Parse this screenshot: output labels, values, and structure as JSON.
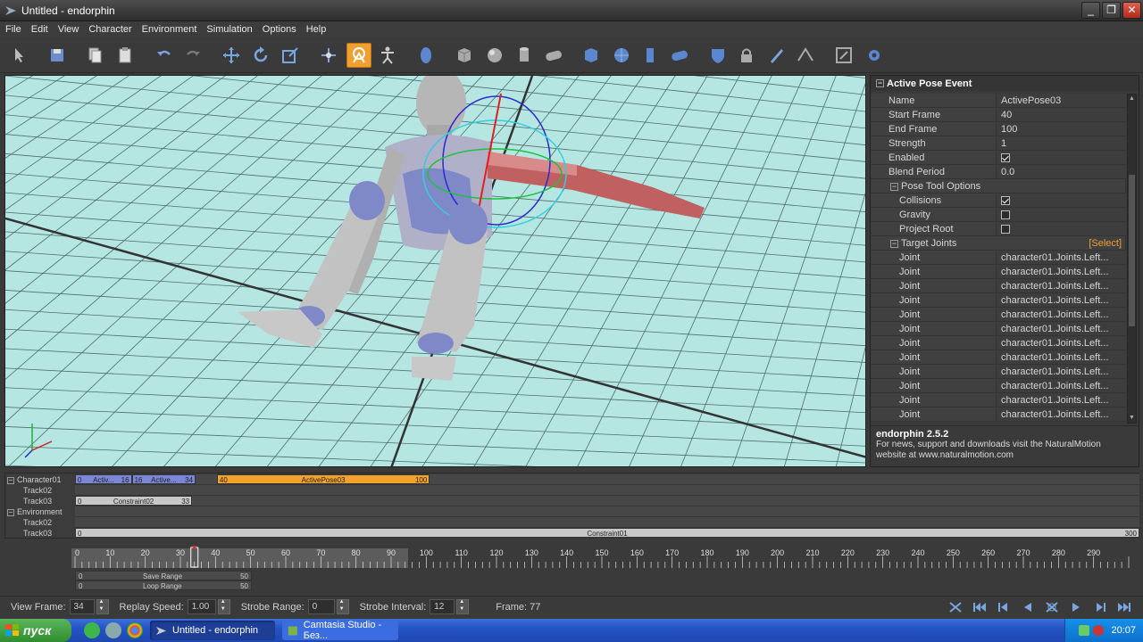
{
  "window": {
    "title": "Untitled - endorphin",
    "minimize": "_",
    "maximize": "❐",
    "close": "✕"
  },
  "menu": [
    "File",
    "Edit",
    "View",
    "Character",
    "Environment",
    "Simulation",
    "Options",
    "Help"
  ],
  "toolbar": {
    "icons": [
      "select-icon",
      "save-icon",
      "copy-icon",
      "paste-icon",
      "undo-icon",
      "redo-icon",
      "move-icon",
      "rotate-icon",
      "scale-icon",
      "joint-move-icon",
      "pose-tool-icon",
      "character-icon",
      "shield-icon",
      "box-icon",
      "sphere-icon",
      "cylinder-icon",
      "capsule-icon",
      "box-blue-icon",
      "mesh-sphere-icon",
      "cylinder-blue-icon",
      "capsule-blue-icon",
      "shield-blue-icon",
      "lock-icon",
      "pen-icon",
      "ruler-icon",
      "export-icon",
      "settings-icon"
    ],
    "active": "pose-tool-icon"
  },
  "viewport": {
    "overlay_label": ""
  },
  "properties": {
    "header": "Active Pose Event",
    "rows": [
      {
        "key": "Name",
        "value": "ActivePose03"
      },
      {
        "key": "Start Frame",
        "value": "40"
      },
      {
        "key": "End Frame",
        "value": "100"
      },
      {
        "key": "Strength",
        "value": "1"
      },
      {
        "key": "Enabled",
        "checked": true
      },
      {
        "key": "Blend Period",
        "value": "0.0"
      }
    ],
    "pose_tool_options": {
      "label": "Pose Tool Options",
      "rows": [
        {
          "key": "Collisions",
          "checked": true
        },
        {
          "key": "Gravity",
          "checked": false
        },
        {
          "key": "Project Root",
          "checked": false
        }
      ]
    },
    "target_joints": {
      "label": "Target Joints",
      "select_label": "[Select]",
      "rows": [
        {
          "key": "Joint",
          "value": "character01.Joints.Left..."
        },
        {
          "key": "Joint",
          "value": "character01.Joints.Left..."
        },
        {
          "key": "Joint",
          "value": "character01.Joints.Left..."
        },
        {
          "key": "Joint",
          "value": "character01.Joints.Left..."
        },
        {
          "key": "Joint",
          "value": "character01.Joints.Left..."
        },
        {
          "key": "Joint",
          "value": "character01.Joints.Left..."
        },
        {
          "key": "Joint",
          "value": "character01.Joints.Left..."
        },
        {
          "key": "Joint",
          "value": "character01.Joints.Left..."
        },
        {
          "key": "Joint",
          "value": "character01.Joints.Left..."
        },
        {
          "key": "Joint",
          "value": "character01.Joints.Left..."
        },
        {
          "key": "Joint",
          "value": "character01.Joints.Left..."
        },
        {
          "key": "Joint",
          "value": "character01.Joints.Left..."
        }
      ]
    }
  },
  "info": {
    "title": "endorphin 2.5.2",
    "text": "For news, support and downloads visit the NaturalMotion website at www.naturalmotion.com"
  },
  "tracks": [
    {
      "label": "Character01",
      "group": true,
      "clips": [
        {
          "start_label": "0",
          "center": "Activ...",
          "end_label": "16",
          "color": "#7b86d6",
          "from": 0,
          "to": 16
        },
        {
          "start_label": "16",
          "center": "Active...",
          "end_label": "34",
          "color": "#7b86d6",
          "from": 16,
          "to": 34
        },
        {
          "start_label": "40",
          "center": "ActivePose03",
          "end_label": "100",
          "color": "#f3a22c",
          "from": 40,
          "to": 100
        }
      ]
    },
    {
      "label": "Track02",
      "group": false,
      "clips": []
    },
    {
      "label": "Track03",
      "group": false,
      "clips": [
        {
          "start_label": "0",
          "center": "Constraint02",
          "end_label": "33",
          "color": "#c8c8c8",
          "from": 0,
          "to": 33
        }
      ]
    },
    {
      "label": "Environment",
      "group": true,
      "clips": []
    },
    {
      "label": "Track02",
      "group": false,
      "clips": []
    },
    {
      "label": "Track03",
      "group": false,
      "clips": [
        {
          "start_label": "0",
          "center": "Constraint01",
          "end_label": "300",
          "color": "#c8c8c8",
          "from": 0,
          "to": 300
        }
      ]
    }
  ],
  "timeline": {
    "ticks": [
      "0",
      "10",
      "20",
      "30",
      "40",
      "50",
      "60",
      "70",
      "80",
      "90",
      "100",
      "110",
      "120",
      "130",
      "140",
      "150",
      "160",
      "170",
      "180",
      "190",
      "200",
      "210",
      "220",
      "230",
      "240",
      "250",
      "260",
      "270",
      "280",
      "290"
    ],
    "max_frame": 300,
    "current_frame": 34,
    "save_range": {
      "label": "Save Range",
      "from": "0",
      "to": "50"
    },
    "loop_range": {
      "label": "Loop Range",
      "from": "0",
      "to": "50"
    }
  },
  "controls": {
    "view_frame_label": "View Frame:",
    "view_frame": "34",
    "replay_speed_label": "Replay Speed:",
    "replay_speed": "1.00",
    "strobe_range_label": "Strobe Range:",
    "strobe_range": "0",
    "strobe_interval_label": "Strobe Interval:",
    "strobe_interval": "12",
    "frame_readout": "Frame: 77",
    "playback_icons": [
      "trim-icon",
      "go-start-icon",
      "step-back-key-icon",
      "play-reverse-icon",
      "loop-icon",
      "play-icon",
      "step-forward-key-icon",
      "go-end-icon"
    ]
  },
  "taskbar": {
    "start_label": "пуск",
    "tasks": [
      {
        "label": "Untitled - endorphin",
        "active": true
      },
      {
        "label": "Camtasia Studio - Без...",
        "active": false
      }
    ],
    "clock": "20:07"
  },
  "colors": {
    "floor": "#b7e8e4",
    "grid": "#2a3a3a",
    "accent": "#f3a22c",
    "active_pose_clip": "#f3a22c",
    "active_clip": "#7b86d6"
  }
}
